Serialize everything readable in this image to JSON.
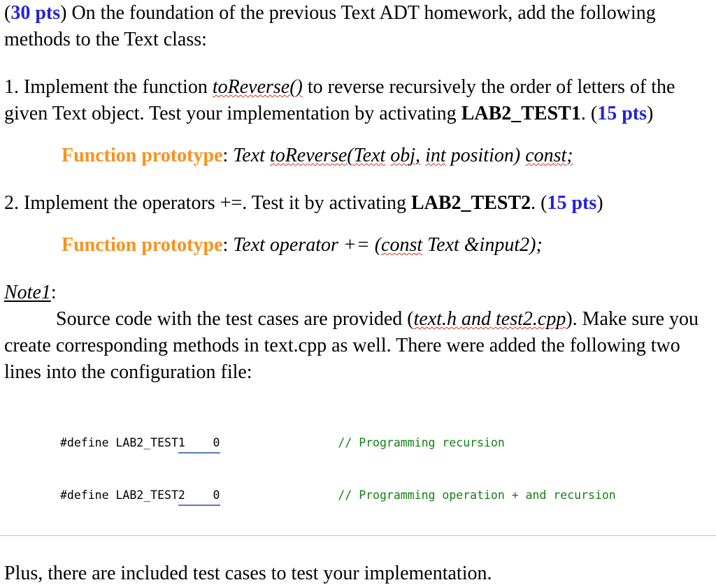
{
  "document": {
    "intro": {
      "open_paren": "(",
      "points": "30 pts",
      "close_paren": ")",
      "text_after": " On the foundation of the previous Text ADT homework, add the following methods to the Text class:"
    },
    "items": [
      {
        "number": "1.",
        "text_before": " Implement the function ",
        "emphasis": "toReverse()",
        "text_middle": " to reverse recursively the order of letters of the given Text object. Test your implementation by activating ",
        "test_macro": "LAB2_TEST1",
        "text_after": ". (",
        "points": "15 pts",
        "text_end": ")",
        "prototype": {
          "label": "Function prototype",
          "separator": ": ",
          "code_part1": "Text ",
          "code_misspelled1": "toReverse(Text",
          "code_space1": " ",
          "code_misspelled2": "obj,",
          "code_space2": " ",
          "code_misspelled3": "int",
          "code_space3": " ",
          "code_part2": "position) ",
          "code_misspelled4": "const;"
        }
      },
      {
        "number": "2.",
        "text_before": " Implement the operators +=. Test it by activating ",
        "test_macro": "LAB2_TEST2",
        "text_after": ". (",
        "points": "15 pts",
        "text_end": ")",
        "prototype": {
          "label": "Function prototype",
          "separator": ": ",
          "code_part1": "Text operator += (",
          "code_misspelled1": "const",
          "code_part2": " Text &input2);"
        }
      }
    ],
    "note": {
      "heading": "Note1",
      "heading_colon": ":",
      "body_before": "Source code with the test cases are provided (",
      "filenames": "text.h and test2.cpp",
      "body_after": "). Make sure you create corresponding methods in text.cpp as well. There were added the following two lines into the configuration file:"
    },
    "code_block": {
      "lines": [
        {
          "define": "#define LAB2_TEST",
          "flagged": "1    0",
          "pad": "                 ",
          "comment": "// Programming recursion"
        },
        {
          "define": "#define LAB2_TEST",
          "flagged": "2    0",
          "pad": "                 ",
          "comment": "// Programming operation + and recursion"
        }
      ]
    },
    "closing": "Plus, there are included test cases to test your implementation.",
    "colors": {
      "points_blue": "#2222dd",
      "prototype_orange": "#f7921e",
      "comment_green": "#128012",
      "spellcheck_red": "#e03020",
      "grammar_blue": "#5577cc",
      "rule_gray": "#bfbfbf",
      "text_black": "#000000"
    }
  }
}
